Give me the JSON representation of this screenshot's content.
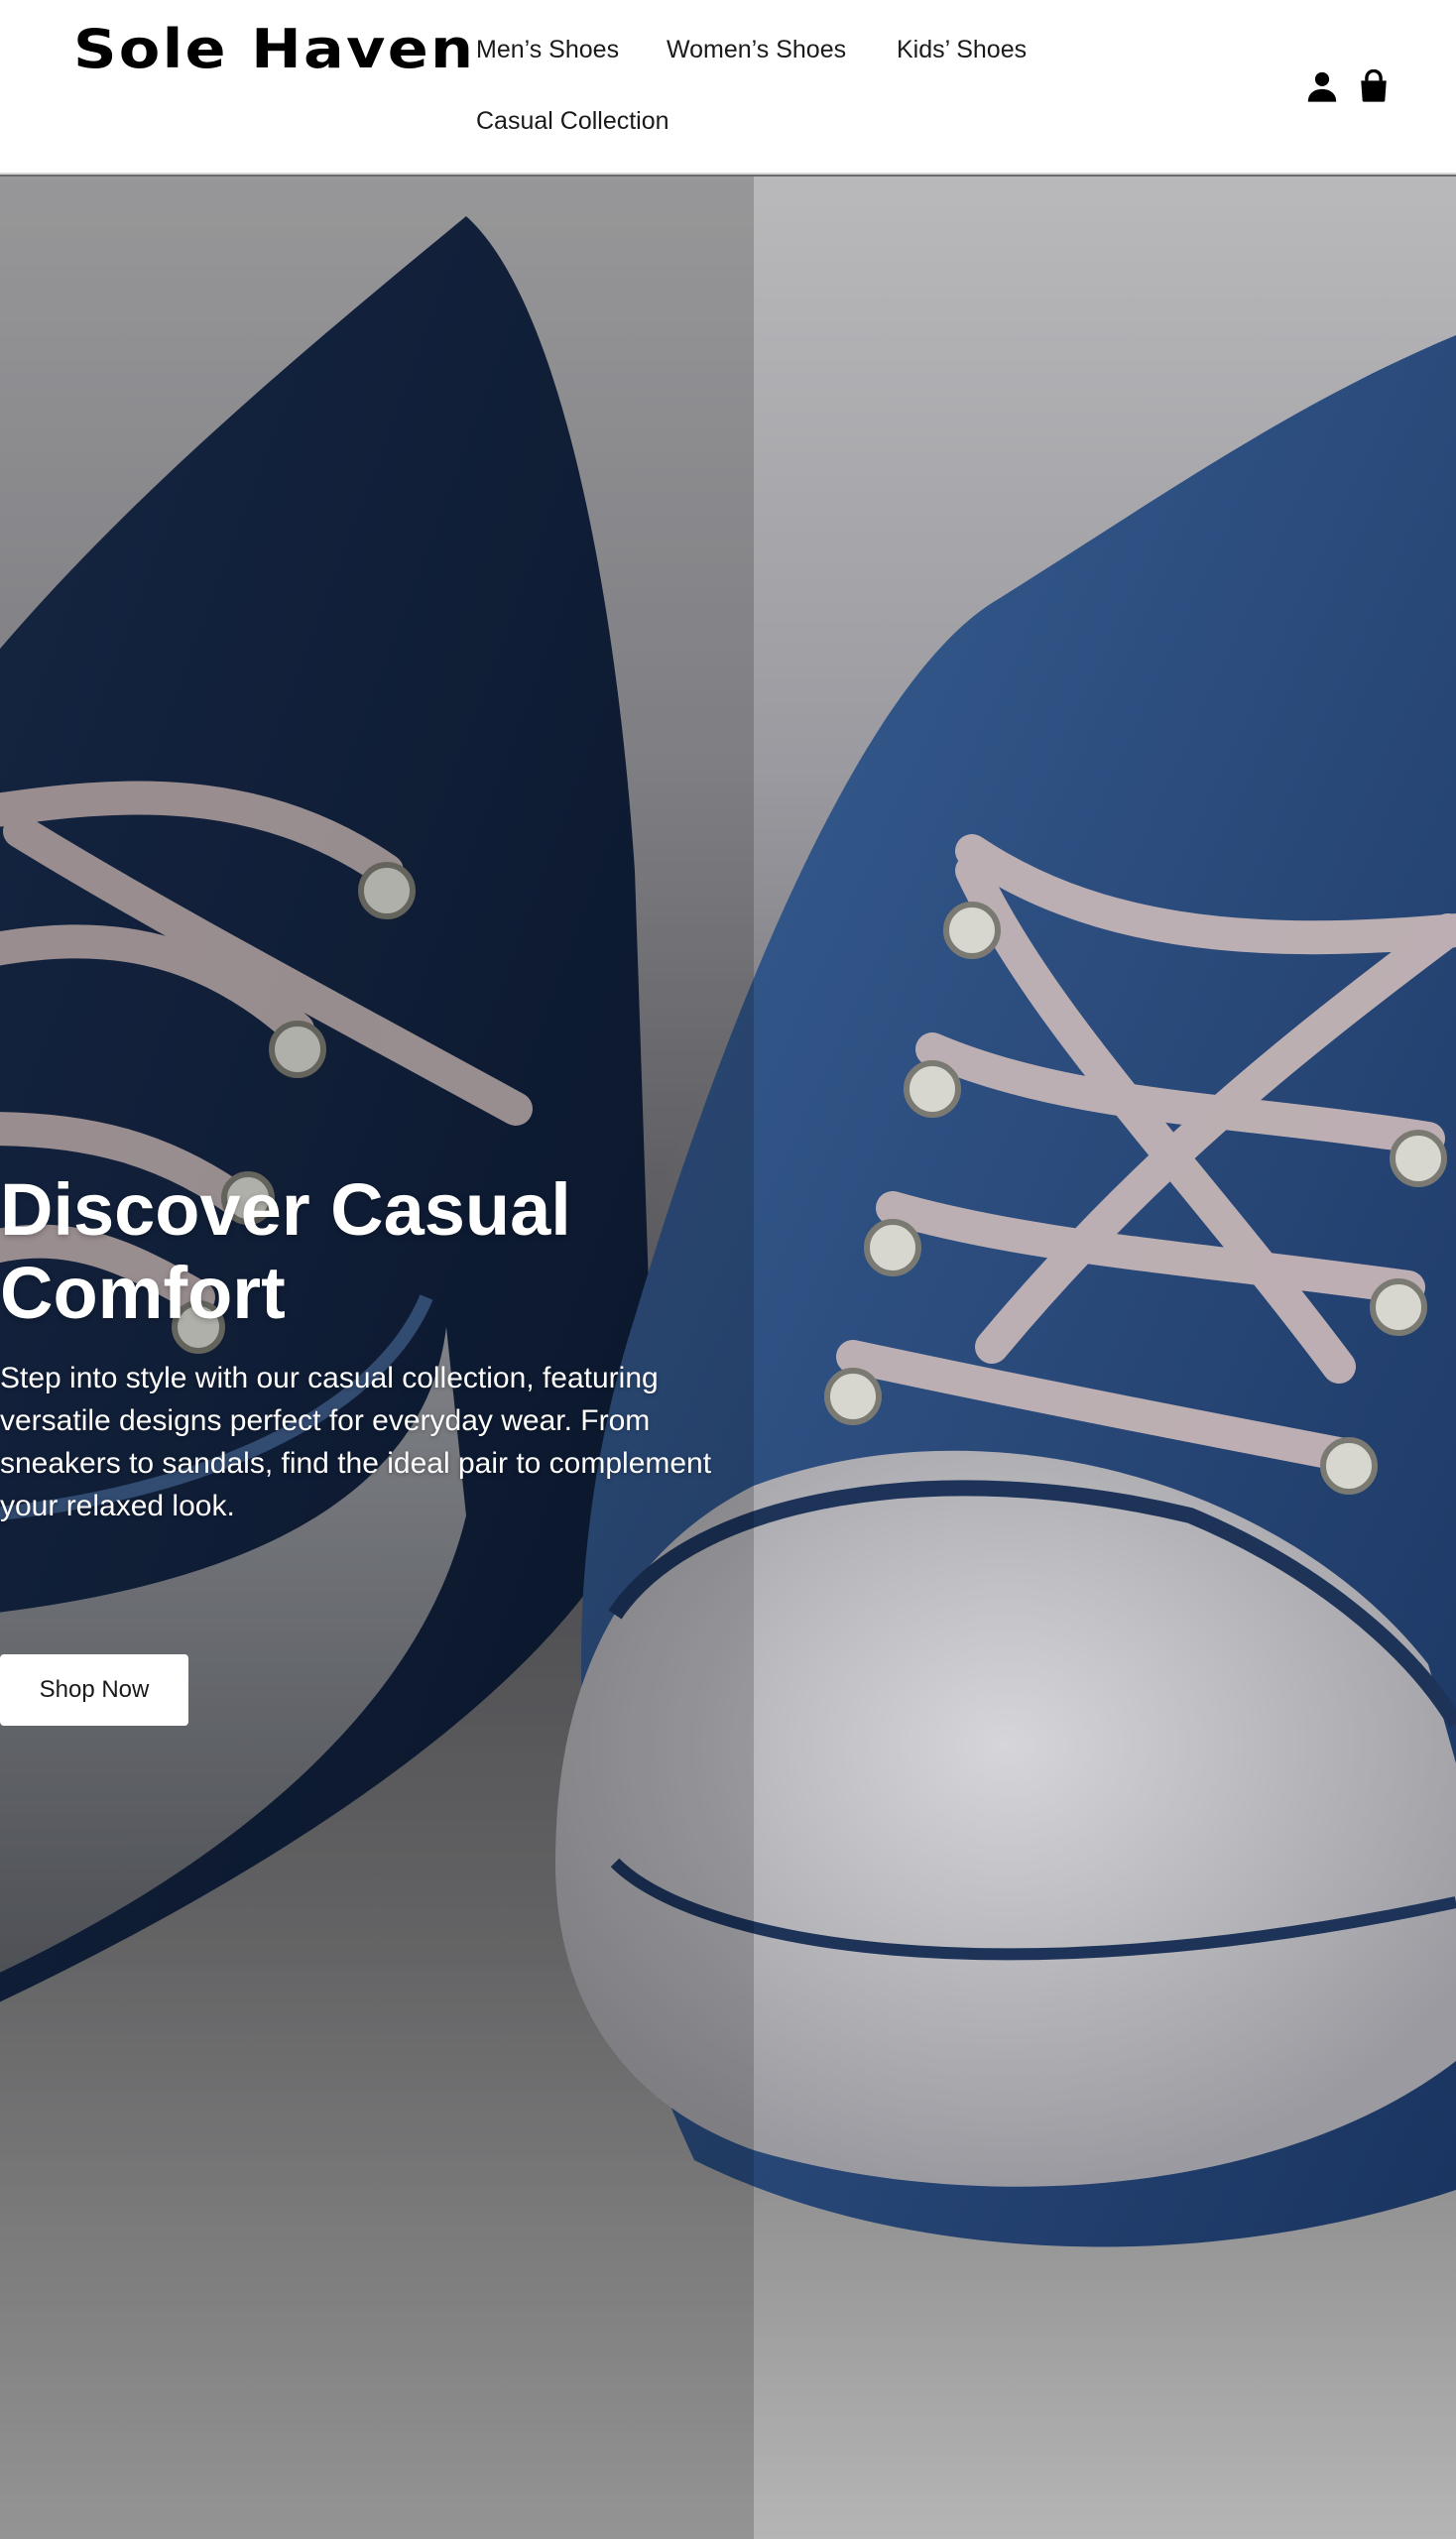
{
  "header": {
    "logo": "Sole Haven",
    "nav": [
      {
        "label": "Men’s Shoes"
      },
      {
        "label": "Women’s Shoes"
      },
      {
        "label": "Kids’ Shoes"
      },
      {
        "label": "Casual Collection"
      }
    ],
    "icons": {
      "account": "user-icon",
      "cart": "shopping-bag-icon"
    }
  },
  "hero": {
    "title": "Discover Casual Comfort",
    "description": "Step into style with our casual collection, featuring versatile designs perfect for everyday wear. From sneakers to sandals, find the ideal pair to complement your relaxed look.",
    "button_label": "Shop Now",
    "image": "blue-canvas-sneakers-photo"
  },
  "colors": {
    "header_bg": "#ffffff",
    "text_dark": "#000000",
    "sneaker_blue": "#2e4f7d",
    "button_bg": "#ffffff"
  }
}
